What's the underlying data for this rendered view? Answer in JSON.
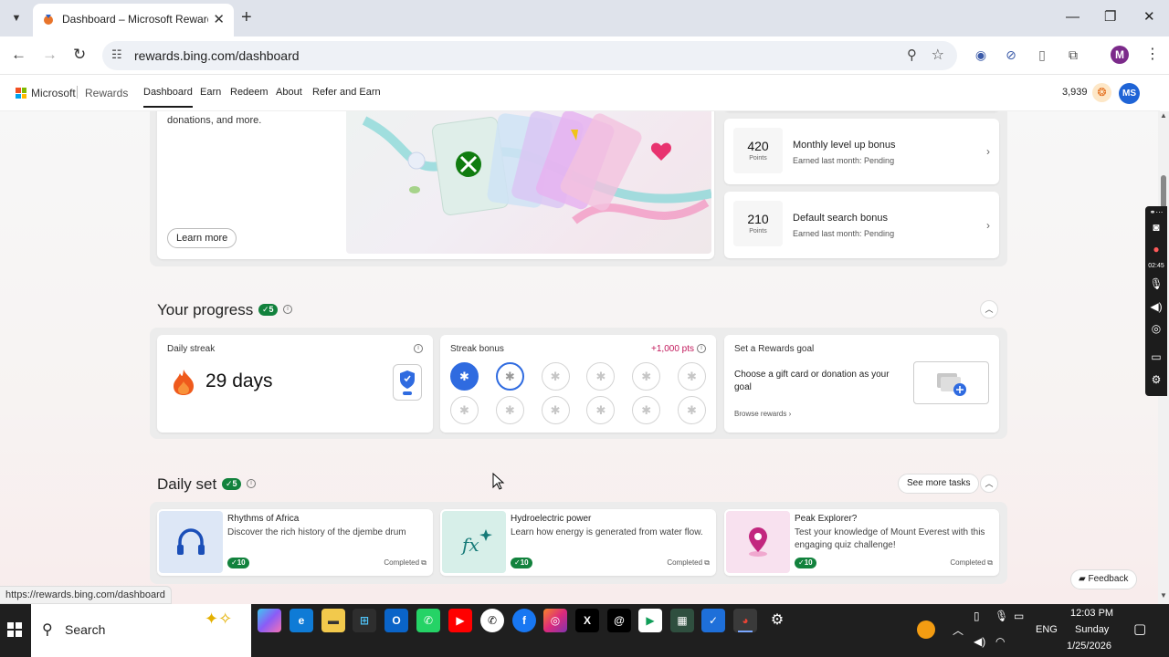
{
  "browser": {
    "tab_title": "Dashboard – Microsoft Rewards",
    "url": "rewards.bing.com/dashboard",
    "status_url": "https://rewards.bing.com/dashboard",
    "profile_initial": "M"
  },
  "site": {
    "brand": "Microsoft",
    "product": "Rewards",
    "nav": [
      "Dashboard",
      "Earn",
      "Redeem",
      "About",
      "Refer and Earn"
    ],
    "points": "3,939",
    "user_initials": "MS"
  },
  "promo": {
    "text": "donations, and more.",
    "learn_more": "Learn more"
  },
  "bonuses": [
    {
      "points": "420",
      "unit": "Points",
      "title": "Monthly level up bonus",
      "sub": "Earned last month: Pending"
    },
    {
      "points": "210",
      "unit": "Points",
      "title": "Default search bonus",
      "sub": "Earned last month: Pending"
    }
  ],
  "progress": {
    "title": "Your progress",
    "badge": "5",
    "daily_streak_label": "Daily streak",
    "streak_days": "29 days",
    "streak_bonus_label": "Streak bonus",
    "streak_bonus_pts": "+1,000 pts",
    "streak_dots_total": 12,
    "streak_dots_filled": 1,
    "goal_label": "Set a Rewards goal",
    "goal_text": "Choose a gift card or donation as your goal",
    "browse": "Browse rewards"
  },
  "daily_set": {
    "title": "Daily set",
    "badge": "5",
    "see_more": "See more tasks",
    "tasks": [
      {
        "title": "Rhythms of Africa",
        "desc": "Discover the rich history of the djembe drum",
        "pts": "10",
        "status": "Completed"
      },
      {
        "title": "Hydroelectric power",
        "desc": "Learn how energy is generated from water flow.",
        "pts": "10",
        "status": "Completed"
      },
      {
        "title": "Peak Explorer?",
        "desc": "Test your knowledge of Mount Everest with this engaging quiz challenge!",
        "pts": "10",
        "status": "Completed"
      }
    ]
  },
  "feedback": "Feedback",
  "recorder": {
    "time": "02:45"
  },
  "taskbar": {
    "search": "Search",
    "lang": "ENG",
    "time": "12:03 PM",
    "day": "Sunday",
    "date": "1/25/2026"
  },
  "colors": {
    "accent_blue": "#2f6be0",
    "badge_green": "#12823d",
    "pts_pink": "#c2185b"
  }
}
